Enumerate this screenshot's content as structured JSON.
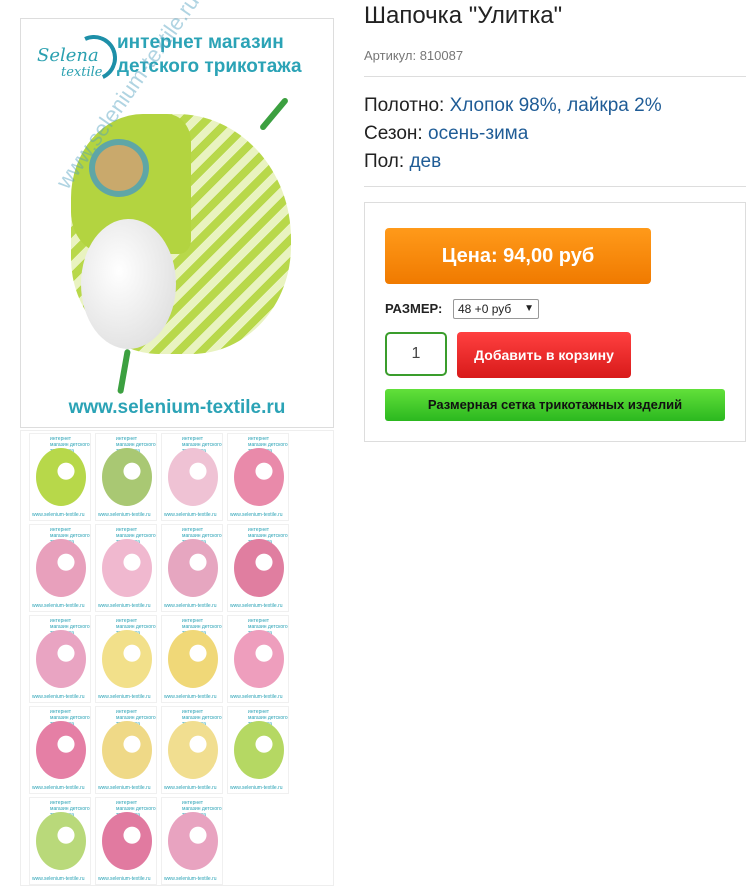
{
  "product": {
    "title": "Шапочка \"Улитка\"",
    "sku_label": "Артикул:",
    "sku_value": "810087"
  },
  "attributes": [
    {
      "label": "Полотно:",
      "value": "Хлопок 98%, лайкра 2%"
    },
    {
      "label": "Сезон:",
      "value": "осень-зима"
    },
    {
      "label": "Пол:",
      "value": "дев"
    }
  ],
  "buy": {
    "price_label": "Цена: 94,00 руб",
    "size_label": "РАЗМЕР:",
    "size_selected": "48 +0 руб",
    "quantity": "1",
    "add_to_cart": "Добавить в корзину",
    "size_chart": "Размерная сетка трикотажных изделий"
  },
  "image_banner": {
    "logo_line1": "Selena",
    "logo_line2": "textile",
    "heading": "интернет магазин детского трикотажа",
    "url": "www.selenium-textile.ru",
    "watermark": "www.selenium-textile.ru"
  },
  "thumbnail_banner": {
    "heading": "интернет магазин детского трикотажа",
    "url": "www.selenium-textile.ru"
  },
  "thumbnails": [
    {
      "color": "#b7d84a"
    },
    {
      "color": "#a9c873"
    },
    {
      "color": "#efc2d4"
    },
    {
      "color": "#e98aaa"
    },
    {
      "color": "#e8a0bc"
    },
    {
      "color": "#f0b8cf"
    },
    {
      "color": "#e6a6c0"
    },
    {
      "color": "#e07ea0"
    },
    {
      "color": "#e9a4c2"
    },
    {
      "color": "#f2e08a"
    },
    {
      "color": "#f0d878"
    },
    {
      "color": "#ee9ebd"
    },
    {
      "color": "#e57fa5"
    },
    {
      "color": "#efd987"
    },
    {
      "color": "#f1de90"
    },
    {
      "color": "#b5d863"
    },
    {
      "color": "#b9d97a"
    },
    {
      "color": "#e17aa0"
    },
    {
      "color": "#e8a3c0"
    }
  ],
  "colors": {
    "link_blue": "#1f5c96",
    "price_orange": "#f7860b",
    "cart_red": "#e52a2a",
    "chart_green": "#41cc2b"
  }
}
